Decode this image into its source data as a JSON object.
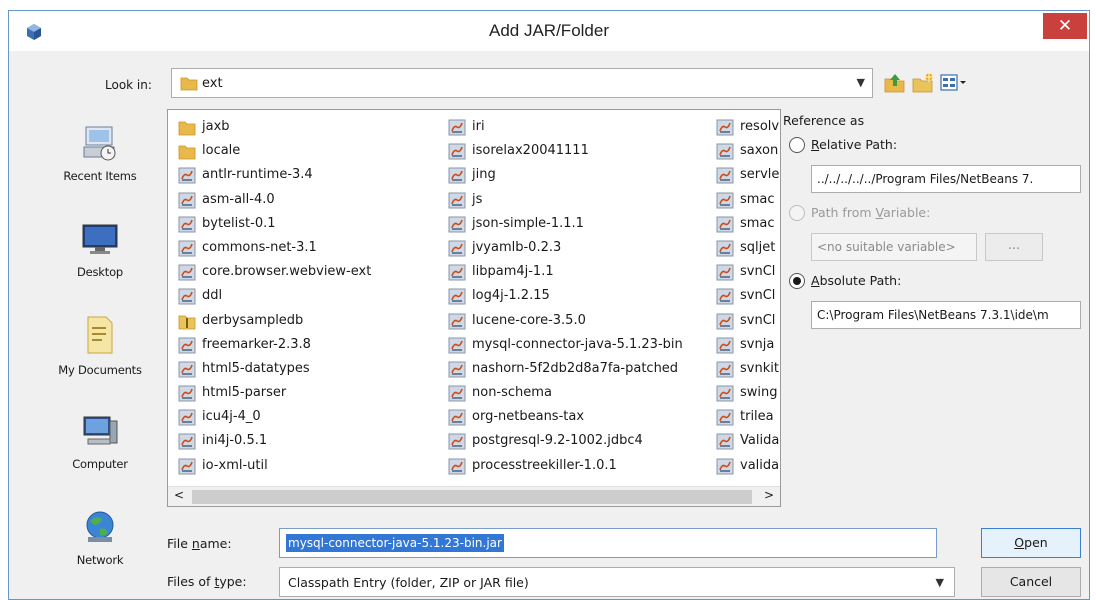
{
  "window": {
    "title": "Add JAR/Folder",
    "close_label": "✕"
  },
  "toolbar": {
    "look_in_label": "Look in:",
    "look_in_value": "ext",
    "icons": [
      "up-folder-icon",
      "new-folder-icon",
      "view-menu-icon"
    ]
  },
  "places": [
    {
      "label": "Recent Items",
      "icon": "recent-items-icon"
    },
    {
      "label": "Desktop",
      "icon": "desktop-icon"
    },
    {
      "label": "My Documents",
      "icon": "documents-icon"
    },
    {
      "label": "Computer",
      "icon": "computer-icon"
    },
    {
      "label": "Network",
      "icon": "network-icon"
    }
  ],
  "files": {
    "col1": [
      {
        "name": "jaxb",
        "type": "folder"
      },
      {
        "name": "locale",
        "type": "folder"
      },
      {
        "name": "antlr-runtime-3.4",
        "type": "jar"
      },
      {
        "name": "asm-all-4.0",
        "type": "jar"
      },
      {
        "name": "bytelist-0.1",
        "type": "jar"
      },
      {
        "name": "commons-net-3.1",
        "type": "jar"
      },
      {
        "name": "core.browser.webview-ext",
        "type": "jar"
      },
      {
        "name": "ddl",
        "type": "jar"
      },
      {
        "name": "derbysampledb",
        "type": "zip"
      },
      {
        "name": "freemarker-2.3.8",
        "type": "jar"
      },
      {
        "name": "html5-datatypes",
        "type": "jar"
      },
      {
        "name": "html5-parser",
        "type": "jar"
      },
      {
        "name": "icu4j-4_0",
        "type": "jar"
      },
      {
        "name": "ini4j-0.5.1",
        "type": "jar"
      },
      {
        "name": "io-xml-util",
        "type": "jar"
      }
    ],
    "col2": [
      {
        "name": "iri",
        "type": "jar"
      },
      {
        "name": "isorelax20041111",
        "type": "jar"
      },
      {
        "name": "jing",
        "type": "jar"
      },
      {
        "name": "js",
        "type": "jar"
      },
      {
        "name": "json-simple-1.1.1",
        "type": "jar"
      },
      {
        "name": "jvyamlb-0.2.3",
        "type": "jar"
      },
      {
        "name": "libpam4j-1.1",
        "type": "jar"
      },
      {
        "name": "log4j-1.2.15",
        "type": "jar"
      },
      {
        "name": "lucene-core-3.5.0",
        "type": "jar"
      },
      {
        "name": "mysql-connector-java-5.1.23-bin",
        "type": "jar"
      },
      {
        "name": "nashorn-5f2db2d8a7fa-patched",
        "type": "jar"
      },
      {
        "name": "non-schema",
        "type": "jar"
      },
      {
        "name": "org-netbeans-tax",
        "type": "jar"
      },
      {
        "name": "postgresql-9.2-1002.jdbc4",
        "type": "jar"
      },
      {
        "name": "processtreekiller-1.0.1",
        "type": "jar"
      }
    ],
    "col3": [
      {
        "name": "resolv",
        "type": "jar"
      },
      {
        "name": "saxon",
        "type": "jar"
      },
      {
        "name": "servle",
        "type": "jar"
      },
      {
        "name": "smac",
        "type": "jar"
      },
      {
        "name": "smac",
        "type": "jar"
      },
      {
        "name": "sqljet",
        "type": "jar"
      },
      {
        "name": "svnCl",
        "type": "jar"
      },
      {
        "name": "svnCl",
        "type": "jar"
      },
      {
        "name": "svnCl",
        "type": "jar"
      },
      {
        "name": "svnja",
        "type": "jar"
      },
      {
        "name": "svnkit",
        "type": "jar"
      },
      {
        "name": "swing",
        "type": "jar"
      },
      {
        "name": "trilea",
        "type": "jar"
      },
      {
        "name": "Valida",
        "type": "jar"
      },
      {
        "name": "valida",
        "type": "jar"
      }
    ]
  },
  "scroll": {
    "left": "<",
    "right": ">"
  },
  "reference": {
    "title": "Reference as",
    "relative": {
      "label_u": "R",
      "label_rest": "elative Path:",
      "value": "../../../../../Program Files/NetBeans 7.",
      "checked": false
    },
    "variable": {
      "label_pre": "Path from ",
      "label_u": "V",
      "label_rest": "ariable:",
      "value": "<no suitable variable>",
      "button": "...",
      "enabled": false
    },
    "absolute": {
      "label_u": "A",
      "label_rest": "bsolute Path:",
      "value": "C:\\Program Files\\NetBeans 7.3.1\\ide\\m",
      "checked": true
    }
  },
  "file_name": {
    "label_pre": "File ",
    "label_u": "n",
    "label_rest": "ame:",
    "value": "mysql-connector-java-5.1.23-bin.jar"
  },
  "file_type": {
    "label_pre": "Files of ",
    "label_u": "t",
    "label_rest": "ype:",
    "value": "Classpath Entry (folder, ZIP or JAR file)"
  },
  "buttons": {
    "open_u": "O",
    "open_rest": "pen",
    "cancel": "Cancel"
  }
}
